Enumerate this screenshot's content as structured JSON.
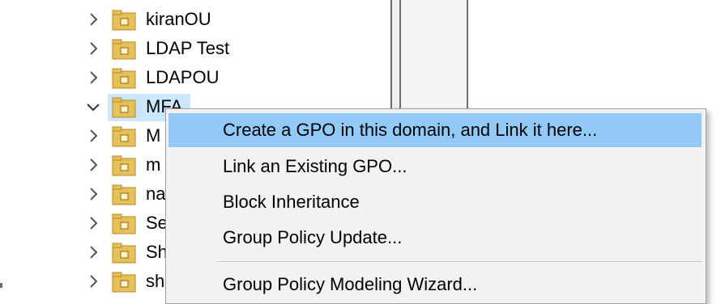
{
  "tree": {
    "items": [
      {
        "label": "kiranOU",
        "expanded": false
      },
      {
        "label": "LDAP Test",
        "expanded": false
      },
      {
        "label": "LDAPOU",
        "expanded": false
      },
      {
        "label": "MFA",
        "expanded": true
      },
      {
        "label": "M",
        "expanded": false
      },
      {
        "label": "m",
        "expanded": false
      },
      {
        "label": "na",
        "expanded": false
      },
      {
        "label": "Se",
        "expanded": false
      },
      {
        "label": "Sh",
        "expanded": false
      },
      {
        "label": "sh",
        "expanded": false
      }
    ]
  },
  "context_menu": {
    "items": [
      {
        "label": "Create a GPO in this domain, and Link it here..."
      },
      {
        "label": "Link an Existing GPO..."
      },
      {
        "label": "Block Inheritance"
      },
      {
        "label": "Group Policy Update..."
      },
      {
        "label": "Group Policy Modeling Wizard..."
      }
    ]
  },
  "colors": {
    "selection": "#cce8ff",
    "menu_hover": "#91c9f7",
    "menu_bg": "#f2f2f2",
    "folder": "#e8c05a"
  }
}
